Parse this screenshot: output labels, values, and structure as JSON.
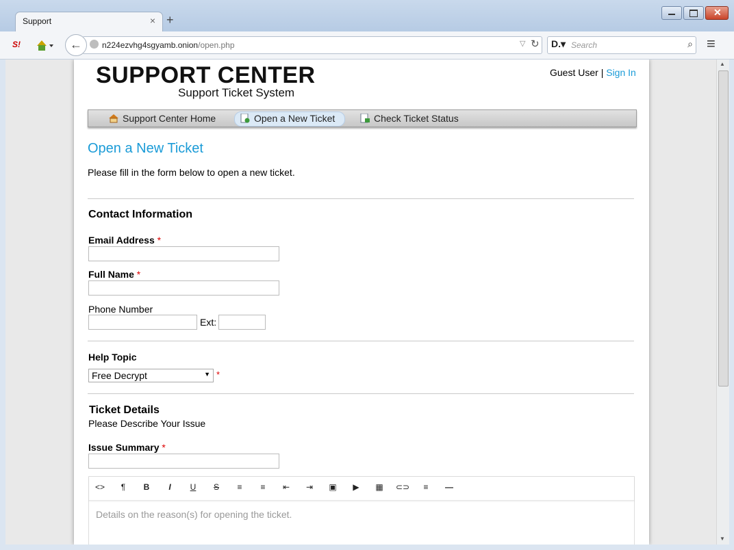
{
  "browser": {
    "tab_title": "Support",
    "tab_close": "×",
    "new_tab": "+",
    "url_host": "n224ezvhg4sgyamb.onion",
    "url_path": "/open.php",
    "search_placeholder": "Search",
    "back_glyph": "←",
    "reload_glyph": "↻",
    "menu_glyph": "≡"
  },
  "header": {
    "logo_title": "SUPPORT CENTER",
    "logo_subtitle": "Support Ticket System",
    "guest": "Guest User",
    "separator": "|",
    "sign_in": "Sign In"
  },
  "nav": {
    "items": [
      {
        "label": "Support Center Home"
      },
      {
        "label": "Open a New Ticket"
      },
      {
        "label": "Check Ticket Status"
      }
    ]
  },
  "page": {
    "title": "Open a New Ticket",
    "intro": "Please fill in the form below to open a new ticket.",
    "contact_heading": "Contact Information",
    "email_label": "Email Address",
    "name_label": "Full Name",
    "phone_label": "Phone Number",
    "ext_label": "Ext:",
    "required_mark": "*",
    "help_topic_label": "Help Topic",
    "help_topic_value": "Free Decrypt",
    "ticket_heading": "Ticket Details",
    "ticket_sub": "Please Describe Your Issue",
    "summary_label": "Issue Summary",
    "details_placeholder": "Details on the reason(s) for opening the ticket."
  },
  "editor_toolbar": [
    "<>",
    "¶",
    "B",
    "I",
    "U",
    "S",
    "≡",
    "≡",
    "⇤",
    "⇥",
    "▣",
    "▶",
    "▦",
    "⊂⊃",
    "≡",
    "—"
  ],
  "colors": {
    "accent": "#1a9bd7",
    "required": "#dd0000"
  }
}
